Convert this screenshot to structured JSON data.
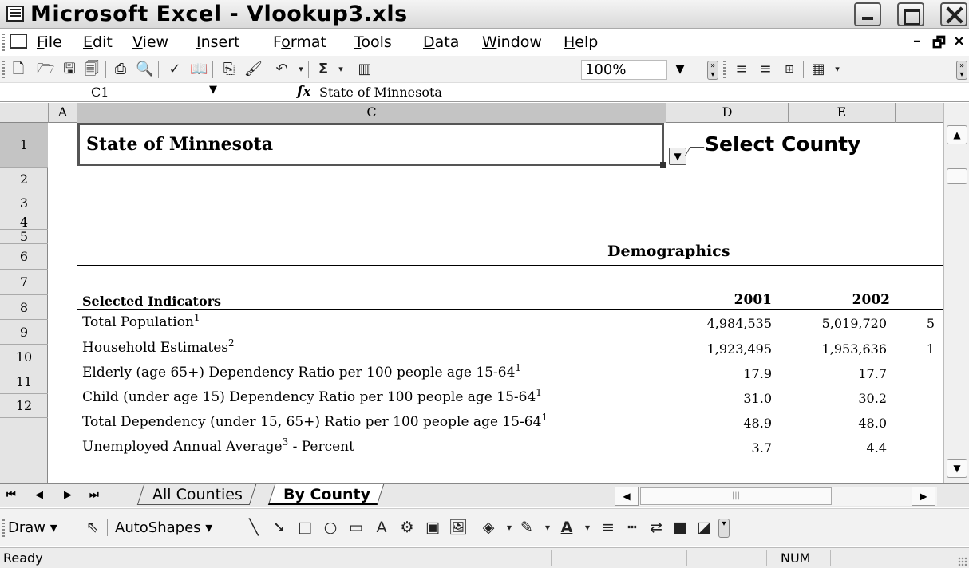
{
  "window": {
    "title": "Microsoft Excel - Vlookup3.xls"
  },
  "menu": {
    "items": [
      {
        "label": "File",
        "accel": "F",
        "rest": "ile"
      },
      {
        "label": "Edit",
        "accel": "E",
        "rest": "dit"
      },
      {
        "label": "View",
        "accel": "V",
        "rest": "iew"
      },
      {
        "label": "Insert",
        "accel": "I",
        "rest": "nsert"
      },
      {
        "label": "Format",
        "accel_pre": "F",
        "accel": "o",
        "rest": "rmat"
      },
      {
        "label": "Tools",
        "accel": "T",
        "rest": "ools"
      },
      {
        "label": "Data",
        "accel": "D",
        "rest": "ata"
      },
      {
        "label": "Window",
        "accel": "W",
        "rest": "indow"
      },
      {
        "label": "Help",
        "accel": "H",
        "rest": "elp"
      }
    ]
  },
  "toolbar": {
    "zoom": "100%",
    "icons": [
      "new-icon",
      "open-icon",
      "save-icon",
      "permission-icon",
      "print-icon",
      "print-preview-icon",
      "spelling-icon",
      "research-icon",
      "copy-icon",
      "format-painter-icon",
      "undo-icon",
      "autosum-icon",
      "chart-wizard-icon",
      "align-left-icon",
      "align-right-icon",
      "merge-center-icon",
      "borders-icon"
    ],
    "autosum_symbol": "Σ"
  },
  "formula_bar": {
    "name_box": "C1",
    "fx_label": "fx",
    "formula": "State of Minnesota"
  },
  "sheet": {
    "columns": [
      "A",
      "C",
      "D",
      "E"
    ],
    "rows": [
      "1",
      "2",
      "3",
      "4",
      "5",
      "6",
      "7",
      "8",
      "9",
      "10",
      "11",
      "12"
    ],
    "selected_cell_text": "State of Minnesota",
    "select_county_label": "Select County",
    "section_title": "Demographics",
    "header_label": "Selected Indicators",
    "years": [
      "2001",
      "2002"
    ],
    "indicators": [
      {
        "label": "Total Population",
        "sup": "1",
        "label_after": "",
        "v2001": "4,984,535",
        "v2002": "5,019,720",
        "vnext": "5"
      },
      {
        "label": "Household Estimates",
        "sup": "2",
        "label_after": "",
        "v2001": "1,923,495",
        "v2002": "1,953,636",
        "vnext": "1"
      },
      {
        "label": "Elderly (age 65+) Dependency Ratio per 100 people age 15-64",
        "sup": "1",
        "label_after": "",
        "v2001": "17.9",
        "v2002": "17.7",
        "vnext": ""
      },
      {
        "label": "Child (under age 15) Dependency Ratio per 100 people age 15-64",
        "sup": "1",
        "label_after": "",
        "v2001": "31.0",
        "v2002": "30.2",
        "vnext": ""
      },
      {
        "label": "Total Dependency (under 15, 65+) Ratio per 100 people age 15-64",
        "sup": "1",
        "label_after": "",
        "v2001": "48.9",
        "v2002": "48.0",
        "vnext": ""
      },
      {
        "label": "Unemployed Annual Average",
        "sup": "3",
        "label_after": " - Percent",
        "v2001": "3.7",
        "v2002": "4.4",
        "vnext": ""
      }
    ]
  },
  "tabs": {
    "items": [
      "All Counties",
      "By County"
    ],
    "active": "By County"
  },
  "draw_toolbar": {
    "draw_label": "Draw",
    "draw_accel": "r",
    "autoshapes_label": "AutoShapes",
    "autoshapes_accel": "u"
  },
  "status": {
    "text": "Ready",
    "num": "NUM"
  },
  "colors": {
    "title_bg": "#e0e0e0",
    "header_bg": "#e4e4e4",
    "selected_header": "#c4c4c4"
  }
}
